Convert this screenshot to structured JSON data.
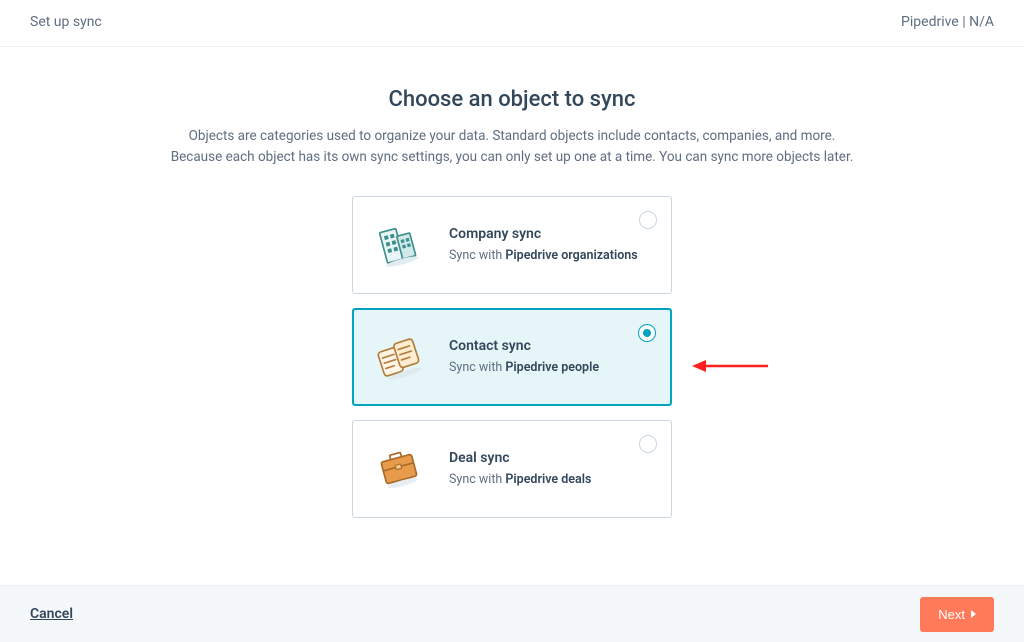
{
  "header": {
    "left_title": "Set up sync",
    "right_title": "Pipedrive | N/A"
  },
  "main": {
    "title": "Choose an object to sync",
    "subtitle_line1": "Objects are categories used to organize your data. Standard objects include contacts, companies, and more.",
    "subtitle_line2": "Because each object has its own sync settings, you can only set up one at a time. You can sync more objects later.",
    "options": [
      {
        "id": "company",
        "title": "Company sync",
        "desc_prefix": "Sync with ",
        "desc_bold": "Pipedrive organizations",
        "selected": false,
        "icon": "buildings-icon"
      },
      {
        "id": "contact",
        "title": "Contact sync",
        "desc_prefix": "Sync with ",
        "desc_bold": "Pipedrive people",
        "selected": true,
        "icon": "contacts-icon"
      },
      {
        "id": "deal",
        "title": "Deal sync",
        "desc_prefix": "Sync with ",
        "desc_bold": "Pipedrive deals",
        "selected": false,
        "icon": "briefcase-icon"
      }
    ]
  },
  "footer": {
    "cancel_label": "Cancel",
    "next_label": "Next"
  }
}
